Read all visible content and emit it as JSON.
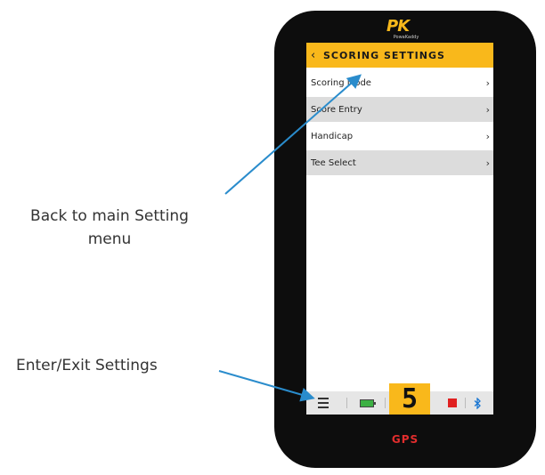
{
  "annotations": {
    "back_label_line1": "Back to main Setting",
    "back_label_line2": "menu",
    "enter_label": "Enter/Exit Settings"
  },
  "device": {
    "logo_mark": "PK",
    "logo_sub": "PowaKaddy",
    "screen_title": "SCORING SETTINGS",
    "menu_items": [
      {
        "label": "Scoring Mode"
      },
      {
        "label": "Score Entry"
      },
      {
        "label": "Handicap"
      },
      {
        "label": "Tee Select"
      }
    ],
    "hole_number": "5",
    "gps_label": "GPS",
    "icons": [
      "back-chevron-icon",
      "chevron-right-icon",
      "menu-icon",
      "battery-icon",
      "stop-icon",
      "bluetooth-icon"
    ]
  },
  "colors": {
    "accent": "#f9b81b",
    "stop": "#e02020",
    "bluetooth": "#1976d2",
    "arrow": "#2a8ccc",
    "gps": "#e22d2d"
  }
}
